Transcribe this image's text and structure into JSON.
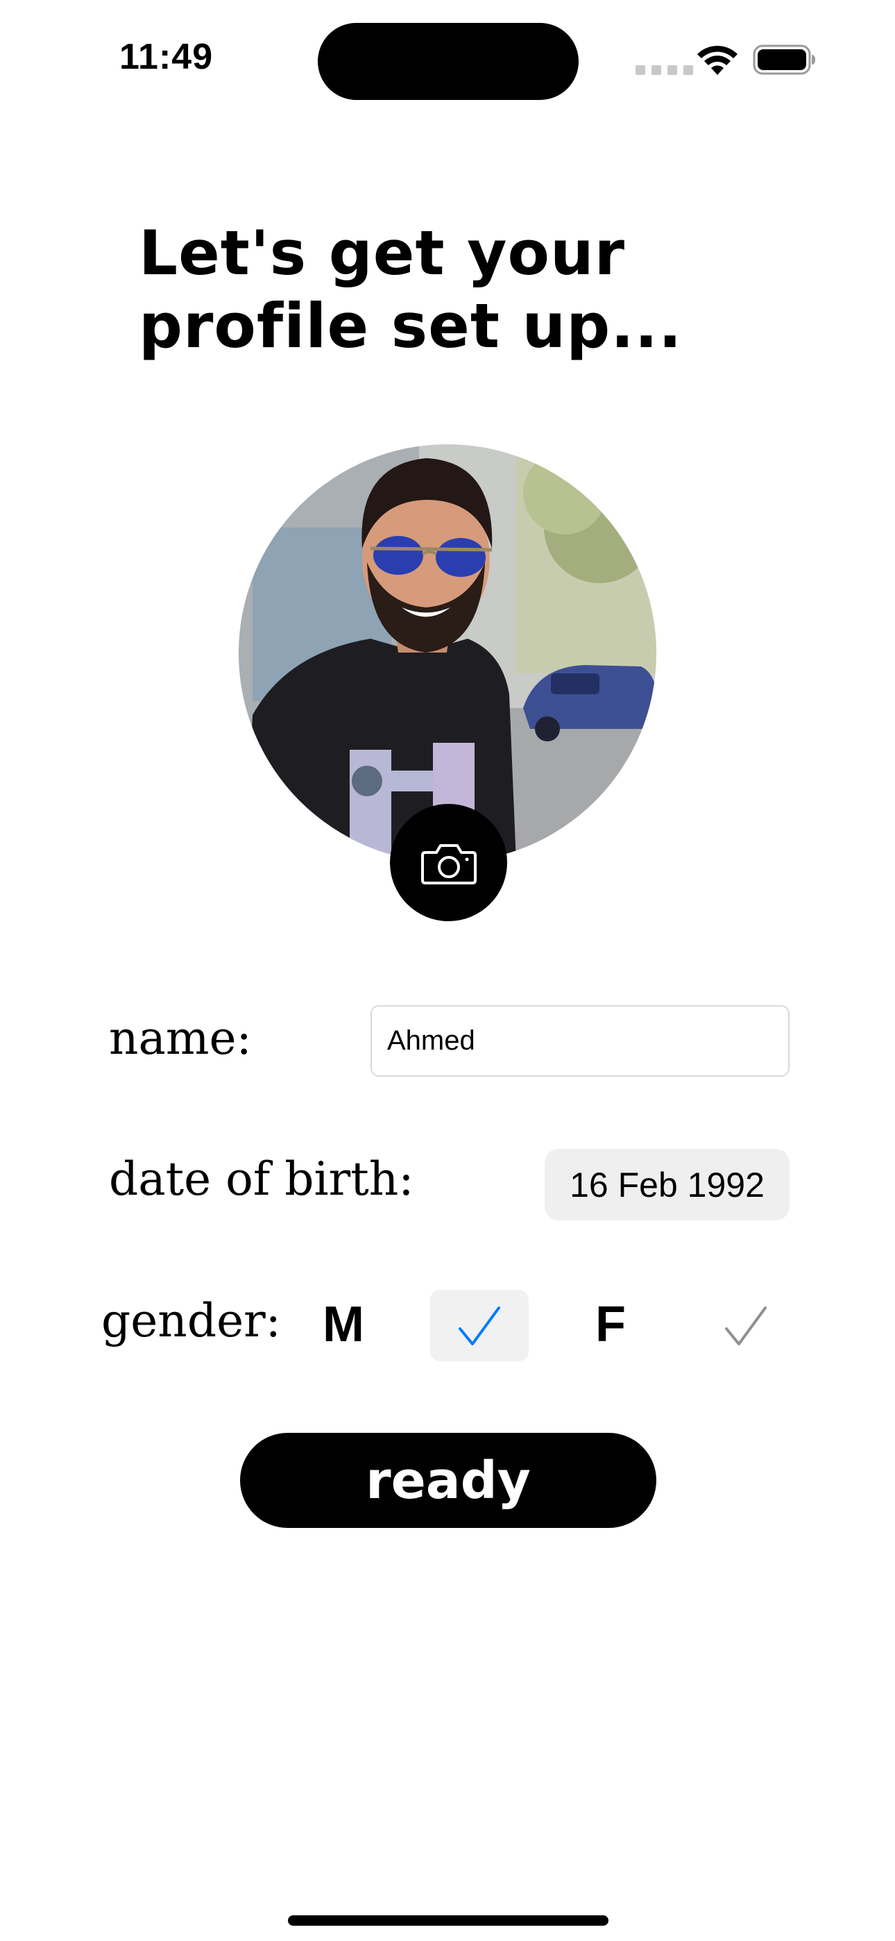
{
  "status_bar": {
    "time": "11:49",
    "icons": [
      "cellular-signal-icon",
      "wifi-icon",
      "battery-icon"
    ]
  },
  "heading": "Let's get your\nprofile set up...",
  "profile": {
    "avatar": "profile-photo",
    "camera_icon": "camera-icon"
  },
  "form": {
    "name_label": "name:",
    "name_value": "Ahmed",
    "dob_label": "date of birth:",
    "dob_value": "16 Feb 1992",
    "gender_label": "gender:",
    "gender_options": [
      {
        "label": "M",
        "selected": true
      },
      {
        "label": "F",
        "selected": false
      }
    ]
  },
  "ready_label": "ready",
  "colors": {
    "accent": "#007aff",
    "unselected_check": "#8e8e93",
    "date_picker_bg": "#efefef",
    "button_bg": "#000000"
  }
}
